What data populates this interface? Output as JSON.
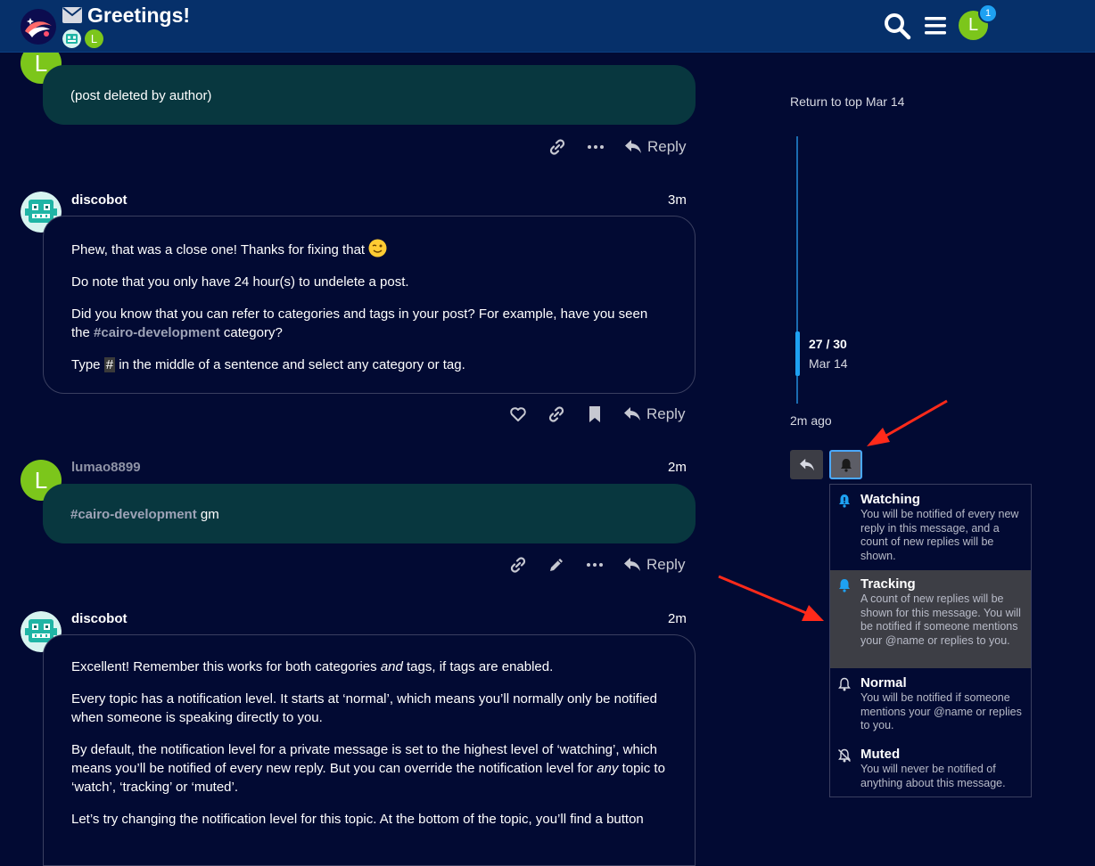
{
  "header": {
    "title": "Greetings!",
    "participant_initial": "L",
    "user_initial": "L",
    "notification_count": "1"
  },
  "posts": [
    {
      "avatar_initial": "L",
      "body": "(post deleted by author)",
      "reply_label": "Reply"
    },
    {
      "username": "discobot",
      "time": "3m",
      "p1": "Phew, that was a close one! Thanks for fixing that",
      "p2": "Do note that you only have 24 hour(s) to undelete a post.",
      "p3_a": "Did you know that you can refer to categories and tags in your post? For example, have you seen the",
      "p3_tag": "#cairo-development",
      "p3_b": " category?",
      "p4_a": "Type ",
      "p4_code": "#",
      "p4_b": " in the middle of a sentence and select any category or tag.",
      "reply_label": "Reply"
    },
    {
      "avatar_initial": "L",
      "username": "lumao8899",
      "time": "2m",
      "tag": "#cairo-development",
      "text": " gm",
      "reply_label": "Reply"
    },
    {
      "username": "discobot",
      "time": "2m",
      "p1_a": "Excellent! Remember this works for both categories ",
      "p1_em": "and",
      "p1_b": " tags, if tags are enabled.",
      "p2": "Every topic has a notification level. It starts at ‘normal’, which means you’ll normally only be notified when someone is speaking directly to you.",
      "p3_a": "By default, the notification level for a private message is set to the highest level of ‘watching’, which means you’ll be notified of every new reply. But you can override the notification level for ",
      "p3_em": "any",
      "p3_b": " topic to ‘watch’, ‘tracking’ or ‘muted’.",
      "p4": "Let’s try changing the notification level for this topic. At the bottom of the topic, you’ll find a button"
    }
  ],
  "timeline": {
    "return_to_top": "Return to top Mar 14",
    "position": "27 / 30",
    "date": "Mar 14",
    "ago": "2m ago",
    "progress": 0.9
  },
  "notification_menu": {
    "options": [
      {
        "title": "Watching",
        "desc": "You will be notified of every new reply in this message, and a count of new replies will be shown."
      },
      {
        "title": "Tracking",
        "desc": "A count of new replies will be shown for this message. You will be notified if someone mentions your @name or replies to you."
      },
      {
        "title": "Normal",
        "desc": "You will be notified if someone mentions your @name or replies to you."
      },
      {
        "title": "Muted",
        "desc": "You will never be notified of anything about this message."
      }
    ],
    "selected": "Tracking"
  },
  "colors": {
    "background": "#020a33",
    "header": "#06306a",
    "own_bubble": "#08373f",
    "accent": "#1ea1f2",
    "avatar_green": "#7cc61b",
    "annotation_red": "#ff2a1a"
  }
}
